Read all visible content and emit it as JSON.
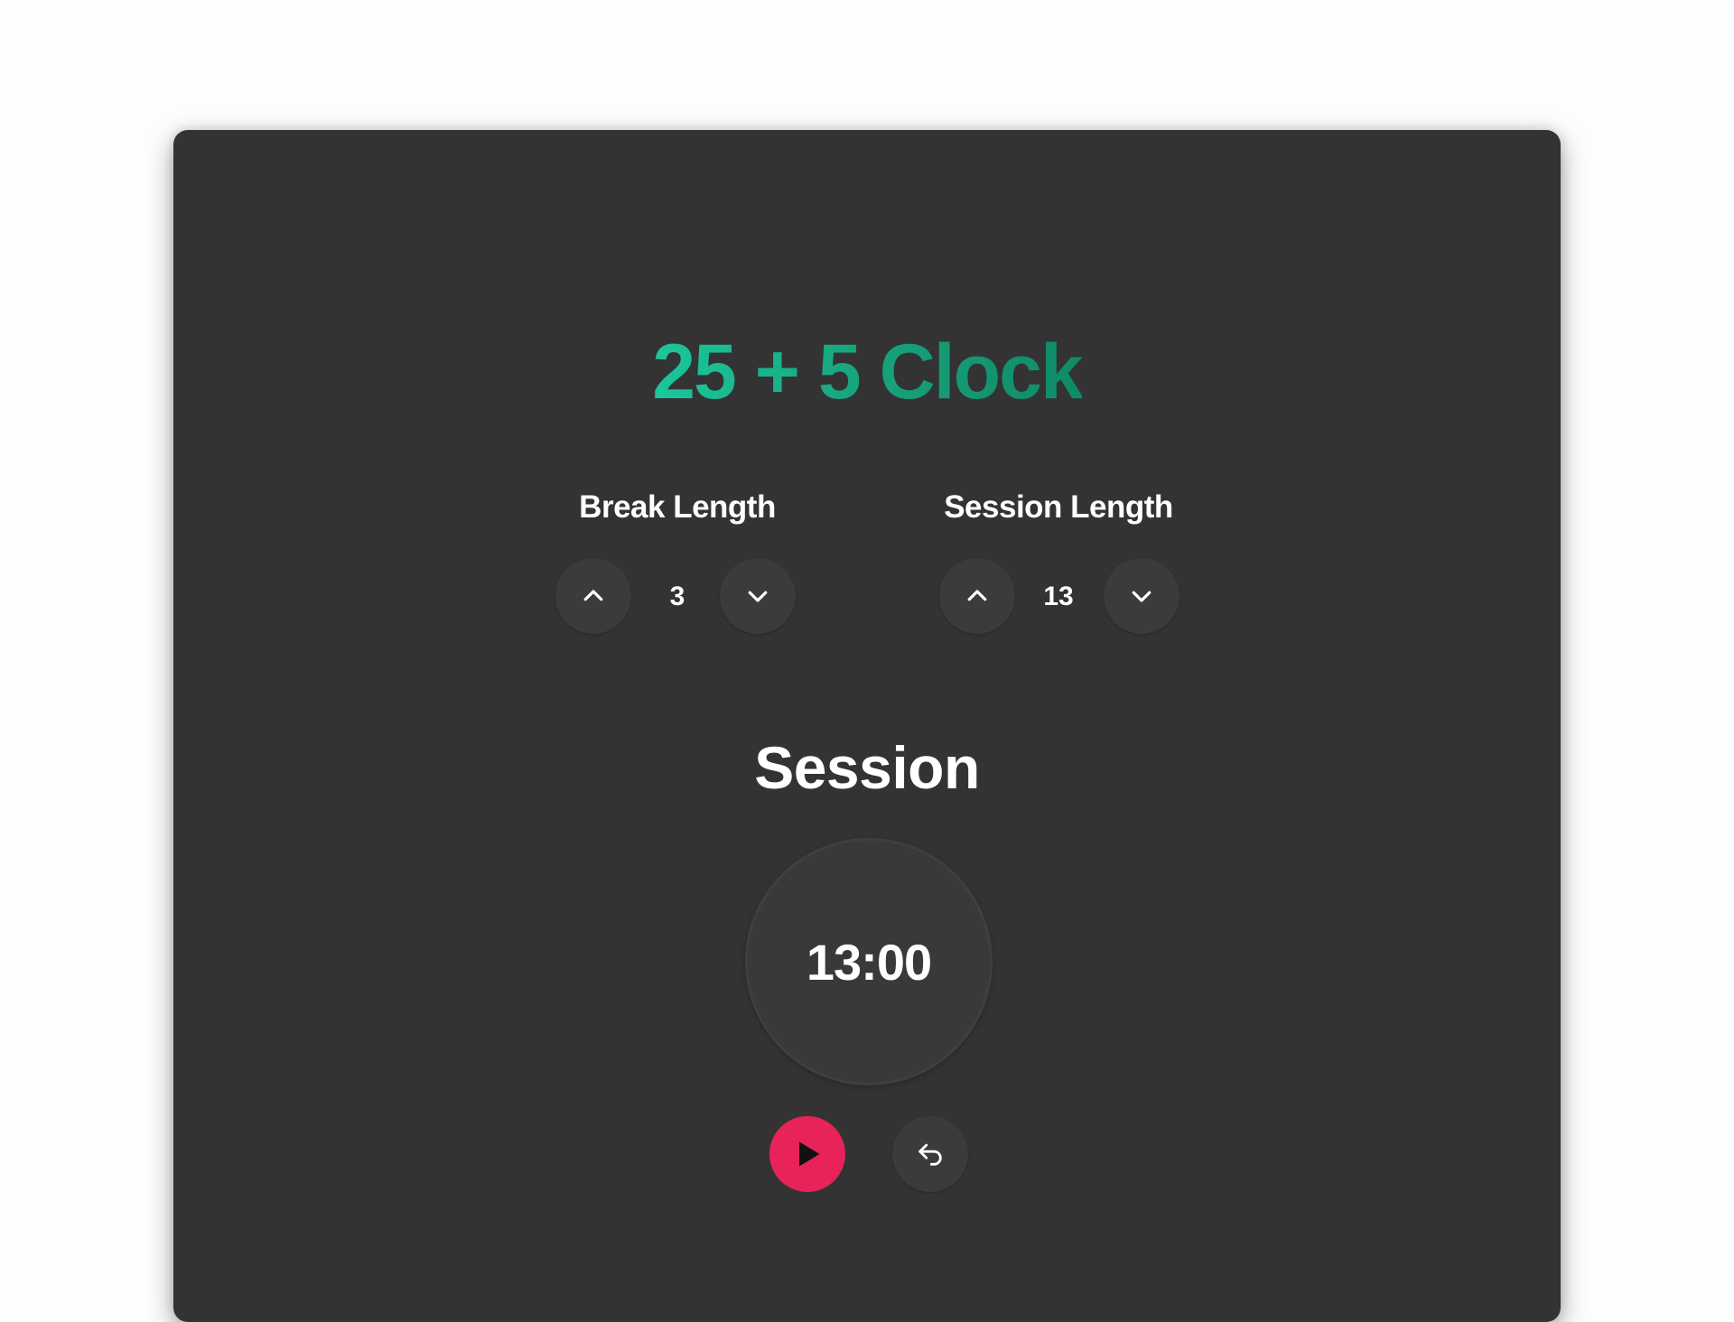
{
  "app": {
    "title": "25 + 5 Clock"
  },
  "break": {
    "label": "Break Length",
    "value": "3",
    "increment_icon": "chevron-up-icon",
    "decrement_icon": "chevron-down-icon"
  },
  "session": {
    "label": "Session Length",
    "value": "13",
    "increment_icon": "chevron-up-icon",
    "decrement_icon": "chevron-down-icon"
  },
  "timer": {
    "label": "Session",
    "time_left": "13:00"
  },
  "controls": {
    "play_icon": "play-icon",
    "reset_icon": "undo-arrow-icon"
  },
  "colors": {
    "card_background": "#333333",
    "title_gradient_start": "#1bc79b",
    "title_gradient_end": "#0f8a66",
    "play_button": "#e8235a",
    "text": "#ffffff"
  }
}
